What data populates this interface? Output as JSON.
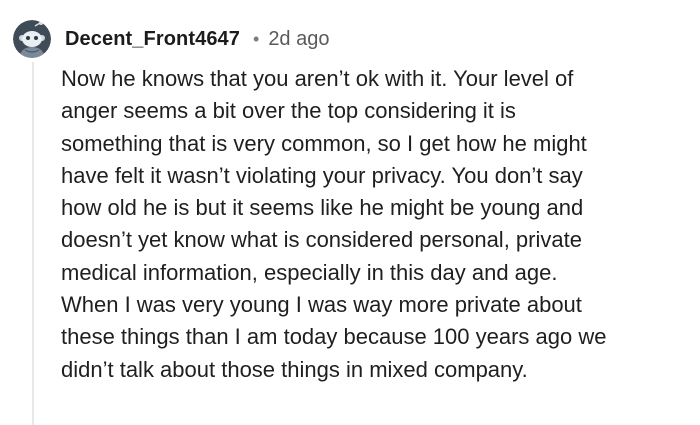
{
  "comment": {
    "author": "Decent_Front4647",
    "separator": "•",
    "timestamp": "2d ago",
    "avatar_icon": "reddit-snoo-avatar-icon",
    "body_lines": [
      "Now he knows that you aren’t ok with it. Your level of",
      "anger seems a bit over the top considering it is",
      "something that is very common, so I get how he might",
      "have felt it wasn’t violating your privacy. You don’t say",
      "how old he is but it seems like he might be young and",
      "doesn’t yet know what is considered personal, private",
      "medical information, especially in this day and age.",
      "When I was very young I was way more private about",
      "these things than I am today because 100 years ago we",
      "didn’t talk about those things in mixed company."
    ]
  },
  "colors": {
    "text": "#1f1f1f",
    "meta": "#5a5a5a",
    "thread_line": "#e6e8ea",
    "avatar_bg": "#3f4c58"
  }
}
